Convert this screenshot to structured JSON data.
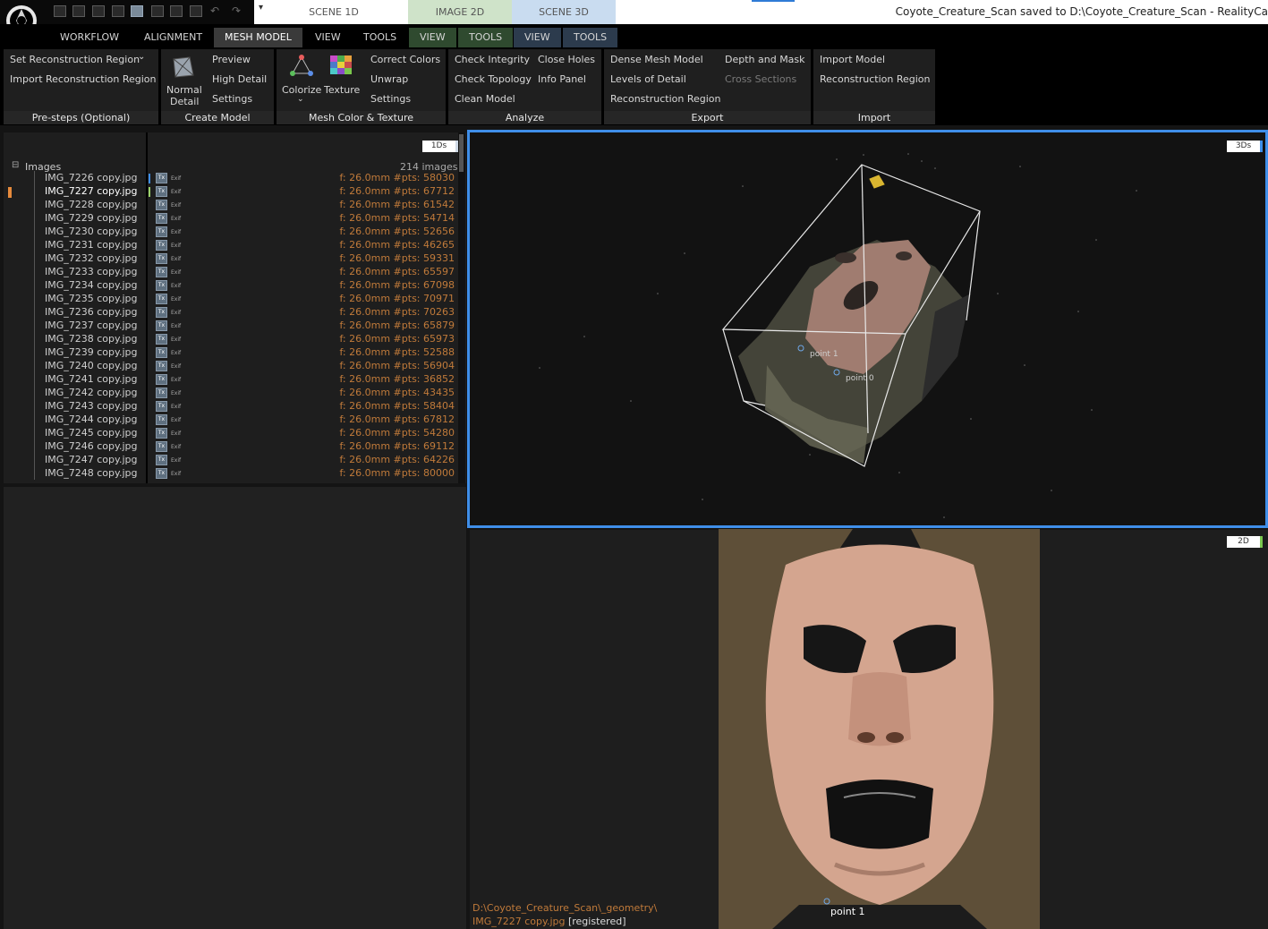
{
  "app": {
    "scene_tabs": [
      "SCENE 1D",
      "IMAGE 2D",
      "SCENE 3D"
    ],
    "title": "Coyote_Creature_Scan saved to D:\\Coyote_Creature_Scan - RealityCa",
    "quick_toolbar_dropdown": "▾"
  },
  "menu": {
    "items": [
      "WORKFLOW",
      "ALIGNMENT",
      "MESH MODEL",
      "VIEW",
      "TOOLS",
      "VIEW",
      "TOOLS",
      "VIEW",
      "TOOLS"
    ],
    "selected": "MESH MODEL"
  },
  "ribbon": {
    "presteps": {
      "label": "Pre-steps (Optional)",
      "set_region": "Set Reconstruction Region",
      "set_region_arrow": "⌄",
      "import_region": "Import Reconstruction Region"
    },
    "create_model": {
      "label": "Create Model",
      "normal": "Normal",
      "detail": "Detail",
      "preview": "Preview",
      "high_detail": "High Detail",
      "settings": "Settings"
    },
    "color_texture": {
      "label": "Mesh Color & Texture",
      "colorize": "Colorize",
      "colorize_arrow": "⌄",
      "texture": "Texture",
      "correct_colors": "Correct Colors",
      "unwrap": "Unwrap",
      "settings": "Settings"
    },
    "analyze": {
      "label": "Analyze",
      "check_integrity": "Check Integrity",
      "check_topology": "Check Topology",
      "clean_model": "Clean Model",
      "close_holes": "Close Holes",
      "info_panel": "Info Panel"
    },
    "export": {
      "label": "Export",
      "dense_mesh": "Dense Mesh Model",
      "levels_of_detail": "Levels of Detail",
      "reconstruction_region": "Reconstruction Region",
      "depth_mask": "Depth and Mask",
      "cross_sections": "Cross Sections"
    },
    "import": {
      "label": "Import",
      "import_model": "Import Model",
      "reconstruction_region": "Reconstruction Region"
    }
  },
  "panel1d": {
    "badge": "1Ds",
    "tree_toggle": "⊟",
    "images_label": "Images",
    "images_count": "214 images",
    "tx_label": "Tx",
    "exif_label": "Exif",
    "rows": [
      {
        "name": "IMG_7226 copy.jpg",
        "info": "f: 26.0mm #pts: 58030"
      },
      {
        "name": "IMG_7227 copy.jpg",
        "info": "f: 26.0mm #pts: 67712"
      },
      {
        "name": "IMG_7228 copy.jpg",
        "info": "f: 26.0mm #pts: 61542"
      },
      {
        "name": "IMG_7229 copy.jpg",
        "info": "f: 26.0mm #pts: 54714"
      },
      {
        "name": "IMG_7230 copy.jpg",
        "info": "f: 26.0mm #pts: 52656"
      },
      {
        "name": "IMG_7231 copy.jpg",
        "info": "f: 26.0mm #pts: 46265"
      },
      {
        "name": "IMG_7232 copy.jpg",
        "info": "f: 26.0mm #pts: 59331"
      },
      {
        "name": "IMG_7233 copy.jpg",
        "info": "f: 26.0mm #pts: 65597"
      },
      {
        "name": "IMG_7234 copy.jpg",
        "info": "f: 26.0mm #pts: 67098"
      },
      {
        "name": "IMG_7235 copy.jpg",
        "info": "f: 26.0mm #pts: 70971"
      },
      {
        "name": "IMG_7236 copy.jpg",
        "info": "f: 26.0mm #pts: 70263"
      },
      {
        "name": "IMG_7237 copy.jpg",
        "info": "f: 26.0mm #pts: 65879"
      },
      {
        "name": "IMG_7238 copy.jpg",
        "info": "f: 26.0mm #pts: 65973"
      },
      {
        "name": "IMG_7239 copy.jpg",
        "info": "f: 26.0mm #pts: 52588"
      },
      {
        "name": "IMG_7240 copy.jpg",
        "info": "f: 26.0mm #pts: 56904"
      },
      {
        "name": "IMG_7241 copy.jpg",
        "info": "f: 26.0mm #pts: 36852"
      },
      {
        "name": "IMG_7242 copy.jpg",
        "info": "f: 26.0mm #pts: 43435"
      },
      {
        "name": "IMG_7243 copy.jpg",
        "info": "f: 26.0mm #pts: 58404"
      },
      {
        "name": "IMG_7244 copy.jpg",
        "info": "f: 26.0mm #pts: 67812"
      },
      {
        "name": "IMG_7245 copy.jpg",
        "info": "f: 26.0mm #pts: 54280"
      },
      {
        "name": "IMG_7246 copy.jpg",
        "info": "f: 26.0mm #pts: 69112"
      },
      {
        "name": "IMG_7247 copy.jpg",
        "info": "f: 26.0mm #pts: 64226"
      },
      {
        "name": "IMG_7248 copy.jpg",
        "info": "f: 26.0mm #pts: 80000"
      }
    ]
  },
  "panel3d": {
    "badge": "3Ds",
    "point1": "point 1",
    "point0": "point 0"
  },
  "panel2d": {
    "badge": "2D",
    "path": "D:\\Coyote_Creature_Scan\\_geometry\\",
    "file": "IMG_7227 copy.jpg",
    "status": "[registered]",
    "point1": "point 1"
  },
  "colors": {
    "accent_blue": "#3f8ee8",
    "path_orange": "#c07a3a",
    "selection_orange": "#e68a3c"
  }
}
